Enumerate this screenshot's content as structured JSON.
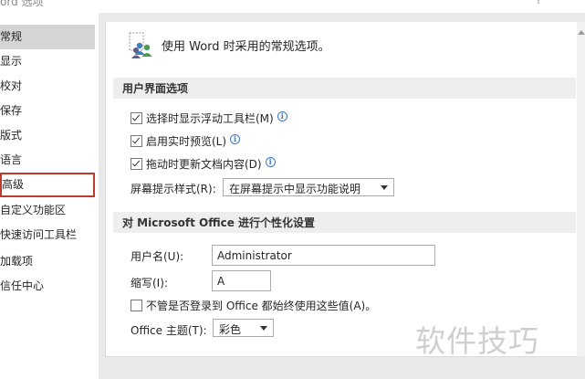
{
  "window": {
    "title": "ord 选项",
    "help_glyph": "?"
  },
  "sidebar": {
    "items": [
      {
        "label": "常规"
      },
      {
        "label": "显示"
      },
      {
        "label": "校对"
      },
      {
        "label": "保存"
      },
      {
        "label": "版式"
      },
      {
        "label": "语言"
      },
      {
        "label": "高级"
      },
      {
        "label": "自定义功能区"
      },
      {
        "label": "快速访问工具栏"
      },
      {
        "label": "加载项"
      },
      {
        "label": "信任中心"
      }
    ]
  },
  "general": {
    "header_icon": "general-options-people-icon",
    "header_text": "使用 Word 时采用的常规选项。",
    "ui_section": {
      "title": "用户界面选项",
      "options": [
        {
          "label": "选择时显示浮动工具栏(M)",
          "checked": true,
          "has_info": true
        },
        {
          "label": "启用实时预览(L)",
          "checked": true,
          "has_info": true
        },
        {
          "label": "拖动时更新文档内容(D)",
          "checked": true,
          "has_info": true
        }
      ],
      "screentip_label": "屏幕提示样式(R):",
      "screentip_value": "在屏幕提示中显示功能说明"
    },
    "personalize_section": {
      "title": "对 Microsoft Office 进行个性化设置",
      "username_label": "用户名(U):",
      "username_value": "Administrator",
      "initials_label": "缩写(I):",
      "initials_value": "A",
      "always_use_label": "不管是否登录到 Office 都始终使用这些值(A)。",
      "always_use_checked": false,
      "theme_label": "Office 主题(T):",
      "theme_value": "彩色"
    }
  },
  "watermark": "软件技巧",
  "colors": {
    "active_nav_bg": "#d5d5d5",
    "highlight_border": "#c0392b",
    "info_icon": "#3b78c2"
  }
}
